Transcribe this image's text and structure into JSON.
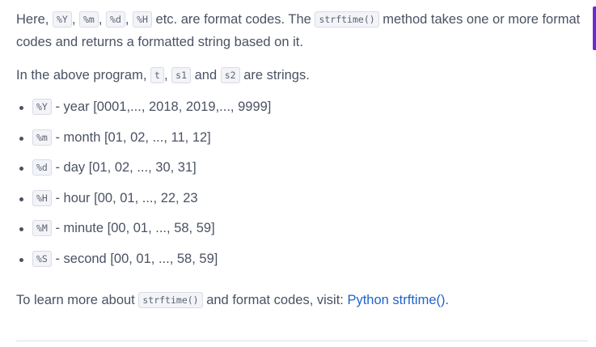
{
  "paragraph1": {
    "t1": "Here,",
    "c1": "%Y",
    "t2": ",",
    "c2": "%m",
    "t3": ",",
    "c3": "%d",
    "t4": ",",
    "c4": "%H",
    "t5": "etc. are format codes. The",
    "c5": "strftime()",
    "t6": "method takes one or more format codes and returns a formatted string based on it."
  },
  "paragraph2": {
    "t1": "In the above program,",
    "c1": "t",
    "t2": ",",
    "c2": "s1",
    "t3": "and",
    "c3": "s2",
    "t4": "are strings."
  },
  "list": [
    {
      "code": "%Y",
      "text": "- year [0001,..., 2018, 2019,..., 9999]"
    },
    {
      "code": "%m",
      "text": "- month [01, 02, ..., 11, 12]"
    },
    {
      "code": "%d",
      "text": "- day [01, 02, ..., 30, 31]"
    },
    {
      "code": "%H",
      "text": "- hour [00, 01, ..., 22, 23"
    },
    {
      "code": "%M",
      "text": "- minute [00, 01, ..., 58, 59]"
    },
    {
      "code": "%S",
      "text": "- second [00, 01, ..., 58, 59]"
    }
  ],
  "paragraph3": {
    "t1": "To learn more about",
    "c1": "strftime()",
    "t2": "and format codes, visit:",
    "link": "Python strftime().",
    "link_color": "#1f63c9"
  },
  "colors": {
    "text": "#4a5263",
    "accent": "#6a29d6",
    "code_bg": "#f3f4f8"
  }
}
